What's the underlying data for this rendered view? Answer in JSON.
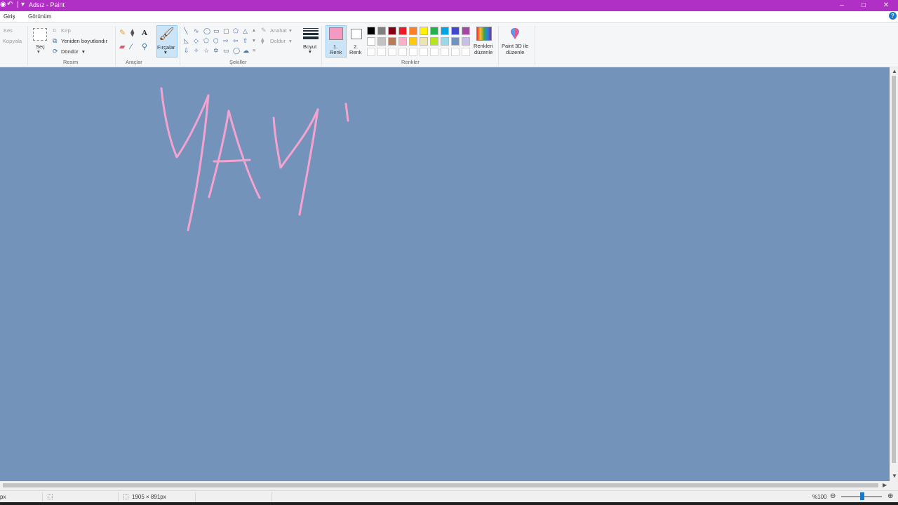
{
  "window": {
    "title": "Adsız - Paint",
    "buttons": {
      "minimize": "–",
      "maximize": "□",
      "close": "✕"
    }
  },
  "tabs": [
    {
      "label": "Giriş",
      "active": true
    },
    {
      "label": "Görünüm",
      "active": false
    }
  ],
  "ribbon": {
    "clipboard": {
      "cut": "Kes",
      "copy": "Kopyala"
    },
    "image": {
      "select": "Seç",
      "crop": "Kırp",
      "resize": "Yeniden boyutlandır",
      "rotate": "Döndür",
      "group_label": "Resim"
    },
    "tools": {
      "group_label": "Araçlar"
    },
    "brushes": {
      "label": "Fırçalar"
    },
    "shapes": {
      "outline": "Anahat",
      "fill": "Doldur",
      "group_label": "Şekiller"
    },
    "size": {
      "label": "Boyut"
    },
    "colors": {
      "color1_number": "1.",
      "color1_word": "Renk",
      "color2_number": "2.",
      "color2_word": "Renk",
      "color1_value": "#f49ac1",
      "color2_value": "#ffffff",
      "edit_line1": "Renkleri",
      "edit_line2": "düzenle",
      "group_label": "Renkler",
      "palette_row1": [
        "#000000",
        "#7f7f7f",
        "#880015",
        "#ed1c24",
        "#ff7f27",
        "#fff200",
        "#22b14c",
        "#00a2e8",
        "#3f48cc",
        "#a349a4"
      ],
      "palette_row2": [
        "#ffffff",
        "#c3c3c3",
        "#b97a57",
        "#ffaec9",
        "#ffc90e",
        "#efe4b0",
        "#b5e61d",
        "#99d9ea",
        "#7092be",
        "#c8bfe7"
      ]
    },
    "paint3d": {
      "line1": "Paint 3D ile",
      "line2": "düzenle"
    }
  },
  "canvas": {
    "background": "#7393bb",
    "stroke_color": "#f4a3cf",
    "drawn_text": "YAY"
  },
  "status": {
    "unit_fragment": "px",
    "canvas_size": "1905 × 891px",
    "zoom": "%100",
    "zoom_level_percent": 100
  }
}
